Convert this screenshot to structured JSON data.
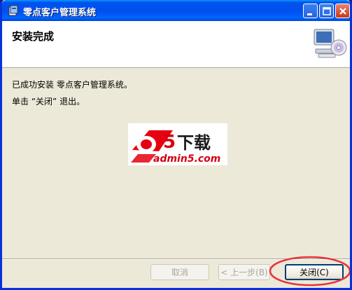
{
  "window": {
    "title": "零点客户管理系统"
  },
  "header": {
    "title": "安装完成",
    "art_icon": "computer-cd-icon"
  },
  "body": {
    "line1": "已成功安装 零点客户管理系统。",
    "line2": "单击 “关闭” 退出。"
  },
  "logo": {
    "text_main": "a5下载",
    "text_sub": "admin5.com"
  },
  "buttons": {
    "cancel": "取消",
    "back": "< 上一步(B)",
    "close": "关闭(C)"
  },
  "colors": {
    "titlebar": "#0053ee",
    "accent_red": "#e60012",
    "highlight": "#e8343a"
  }
}
